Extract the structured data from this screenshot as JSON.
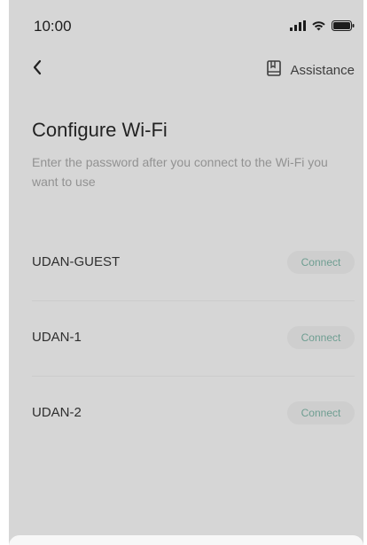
{
  "status_bar": {
    "time": "10:00"
  },
  "topbar": {
    "back_icon": "chevron-left-icon",
    "assist_icon": "guide-book-icon",
    "assist_label": "Assistance"
  },
  "page": {
    "title": "Configure Wi-Fi",
    "subtitle": "Enter the password after you connect to the Wi-Fi you want to use"
  },
  "networks": [
    {
      "name": "UDAN-GUEST",
      "action": "Connect"
    },
    {
      "name": "UDAN-1",
      "action": "Connect"
    },
    {
      "name": "UDAN-2",
      "action": "Connect"
    }
  ],
  "colors": {
    "screen_bg": "#e7e7e7",
    "connect_text": "#72a89a",
    "connect_bg": "#dedede",
    "title_text": "#1b1b1b",
    "subtitle_text": "#9a9a9a"
  }
}
